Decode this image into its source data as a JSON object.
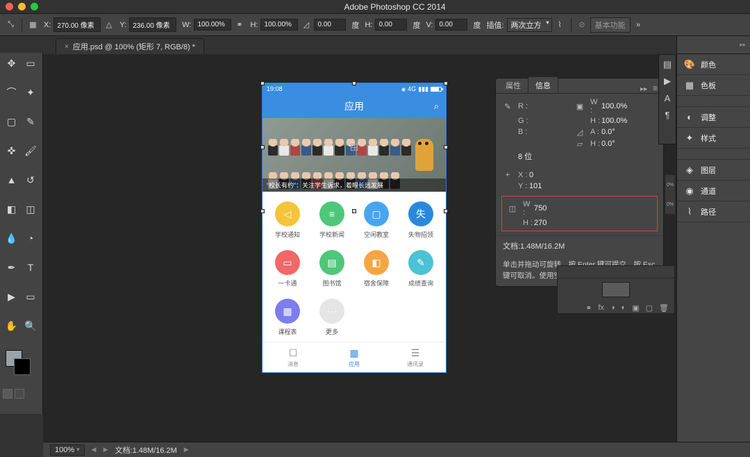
{
  "titlebar": {
    "title": "Adobe Photoshop CC 2014"
  },
  "optbar": {
    "x_label": "X:",
    "x": "270.00 像素",
    "y_label": "Y:",
    "y": "236.00 像素",
    "w_label": "W:",
    "w": "100.00%",
    "h_label": "H:",
    "h": "100.00%",
    "angle_label": "度",
    "angle": "0.00",
    "hskew_label": "H:",
    "hskew": "0.00",
    "vskew_label": "V:",
    "vskew": "0.00",
    "du2": "度",
    "du3": "度",
    "interp_label": "插值:",
    "interp": "两次立方",
    "ws_label": "基本功能"
  },
  "doctab": {
    "name": "应用.psd @ 100% (矩形 7, RGB/8) *"
  },
  "info": {
    "tabs": {
      "props": "属性",
      "info": "信息"
    },
    "rgb": {
      "r": "R :",
      "g": "G :",
      "b": "B :"
    },
    "wh1": {
      "w": "W :",
      "wv": "100.0%",
      "h": "H :",
      "hv": "100.0%",
      "a": "A :",
      "av": "0.0°",
      "s": "H :",
      "sv": "0.0°"
    },
    "bit": "8 位",
    "xy": {
      "x": "X :",
      "xv": "0",
      "y": "Y :",
      "yv": "101"
    },
    "wh2": {
      "w": "W :",
      "wv": "750",
      "h": "H :",
      "hv": "270"
    },
    "doc": "文档:1.48M/16.2M",
    "help": "单击并拖动可旋转。按 Enter 键可提交。按 Esc 键可取消。使用空格键可访问导航工具。"
  },
  "rpanels": {
    "color": "颜色",
    "swatch": "色板",
    "adjust": "调整",
    "styles": "样式",
    "layers": "图层",
    "channels": "通道",
    "paths": "路径"
  },
  "phone": {
    "time": "19:08",
    "signal": "4G",
    "header": "应用",
    "banner_caption": "“校长有约”：关注学生诉求，着眼长远发展",
    "grid": [
      {
        "label": "学校通知",
        "color": "c-ye",
        "glyph": "◁"
      },
      {
        "label": "学校新闻",
        "color": "c-gr",
        "glyph": "≡"
      },
      {
        "label": "空闲教室",
        "color": "c-bl",
        "glyph": "▢"
      },
      {
        "label": "失物招领",
        "color": "c-bl2",
        "glyph": "失"
      },
      {
        "label": "一卡通",
        "color": "c-rd",
        "glyph": "▭"
      },
      {
        "label": "图书馆",
        "color": "c-gr",
        "glyph": "▤"
      },
      {
        "label": "宿舍保障",
        "color": "c-or",
        "glyph": "◧"
      },
      {
        "label": "成绩查询",
        "color": "c-cy",
        "glyph": "✎"
      },
      {
        "label": "课程表",
        "color": "c-pu",
        "glyph": "▦"
      },
      {
        "label": "更多",
        "color": "c-gy",
        "glyph": "⋯"
      }
    ],
    "tabs": {
      "msg": "消息",
      "app": "应用",
      "contacts": "通讯录"
    }
  },
  "status": {
    "zoom": "100%",
    "doc": "文档:1.48M/16.2M"
  }
}
